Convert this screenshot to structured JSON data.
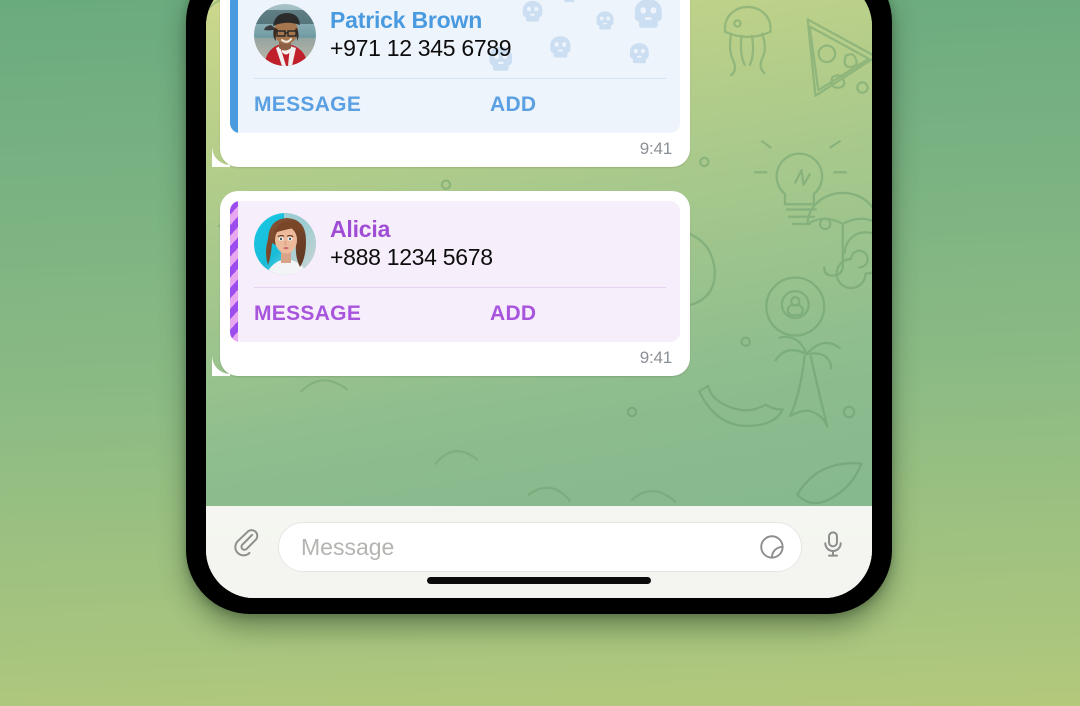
{
  "app": {
    "name": "Telegram",
    "screen": "chat"
  },
  "theme": {
    "page_gradient_top": "#6aab7e",
    "page_gradient_bottom": "#b3c97c",
    "wallpaper_top": "#cfd98e",
    "wallpaper_bottom": "#80b68d",
    "bubble_bg": "#ffffff",
    "input_bar_bg": "#f4f5f0",
    "time_color": "#8b9096"
  },
  "messages": [
    {
      "type": "contact-card",
      "contact": {
        "name": "Patrick Brown",
        "phone": "+971 12 345 6789"
      },
      "avatar": {
        "icon": "avatar-photo-patrick",
        "description": "man in cap and glasses wearing red jacket",
        "bg": "#7fa9ad"
      },
      "actions": {
        "message_label": "MESSAGE",
        "add_label": "ADD"
      },
      "style": {
        "accent_type": "solid",
        "accent_color": "#4a9ae0",
        "card_bg": "#eef4fc",
        "name_color": "#4a9ae0",
        "button_color": "#5ba0e2",
        "separator_color": "#d5e3f3",
        "pattern_icon": "skull-emoji",
        "pattern_color": "#ccdff2"
      },
      "time": "9:41"
    },
    {
      "type": "contact-card",
      "contact": {
        "name": "Alicia",
        "phone": "+888 1234 5678"
      },
      "avatar": {
        "icon": "avatar-photo-alicia",
        "description": "woman with auburn hair on cyan background",
        "bg": "#1ec8e0"
      },
      "actions": {
        "message_label": "MESSAGE",
        "add_label": "ADD"
      },
      "style": {
        "accent_type": "striped",
        "accent_color": "#9b4ded",
        "accent_stripe_a": "#e8a8f0",
        "accent_stripe_b": "#9b4ded",
        "card_bg": "#f6eefb",
        "name_color": "#a04dd6",
        "button_color": "#a855dd",
        "separator_color": "#e6d4f0",
        "pattern_icon": "none",
        "pattern_color": "#f0e2f8"
      },
      "time": "9:41"
    }
  ],
  "input_bar": {
    "attach_icon": "paperclip-icon",
    "placeholder": "Message",
    "value": "",
    "sticker_icon": "sticker-icon",
    "voice_icon": "microphone-icon"
  },
  "system": {
    "home_indicator": "home-indicator"
  }
}
